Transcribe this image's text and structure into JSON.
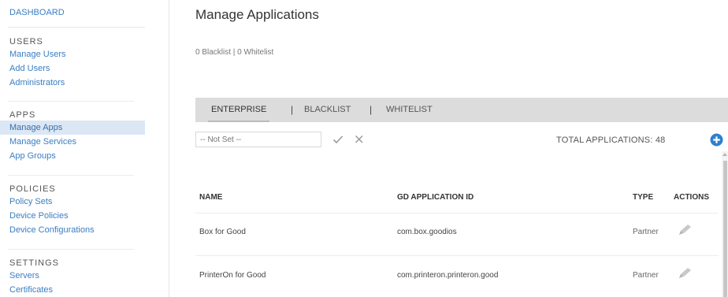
{
  "sidebar": {
    "dashboard": "DASHBOARD",
    "sections": [
      {
        "title": "USERS",
        "items": [
          "Manage Users",
          "Add Users",
          "Administrators"
        ]
      },
      {
        "title": "APPS",
        "items": [
          "Manage Apps",
          "Manage Services",
          "App Groups"
        ]
      },
      {
        "title": "POLICIES",
        "items": [
          "Policy Sets",
          "Device Policies",
          "Device Configurations"
        ]
      },
      {
        "title": "SETTINGS",
        "items": [
          "Servers",
          "Certificates"
        ]
      }
    ],
    "active_item": "Manage Apps"
  },
  "main": {
    "title": "Manage Applications",
    "summary": "0 Blacklist | 0 Whitelist",
    "tabs": [
      "ENTERPRISE",
      "BLACKLIST",
      "WHITELIST"
    ],
    "active_tab": "ENTERPRISE",
    "tab_separator": "|",
    "filter_placeholder": "-- Not Set --",
    "total_label": "TOTAL APPLICATIONS: 48",
    "table": {
      "headers": [
        "NAME",
        "GD APPLICATION ID",
        "TYPE",
        "ACTIONS"
      ],
      "rows": [
        {
          "name": "Box for Good",
          "id": "com.box.goodios",
          "type": "Partner"
        },
        {
          "name": "PrinterOn for Good",
          "id": "com.printeron.printeron.good",
          "type": "Partner"
        }
      ]
    }
  },
  "icons": {
    "check": "check-icon",
    "clear": "close-icon",
    "add": "plus-circle-icon",
    "edit": "pencil-icon"
  },
  "colors": {
    "link": "#3a7dc3",
    "active_bg": "#dbe7f5",
    "tabbar_bg": "#dcdcdc",
    "add_button": "#2f7fd0"
  }
}
